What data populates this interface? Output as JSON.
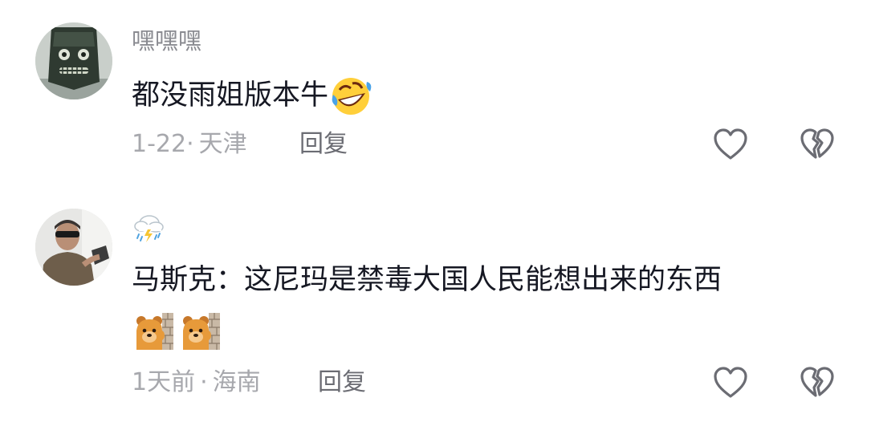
{
  "comments": [
    {
      "username": "嘿嘿嘿",
      "avatar_icon": "bronze-mask-avatar",
      "text": "都没雨姐版本牛",
      "emoji": "rolling-laughing-emoji",
      "date": "1-22",
      "location": "天津",
      "reply_label": "回复",
      "like_icon": "heart-icon",
      "dislike_icon": "broken-heart-icon"
    },
    {
      "username_icon": "thunder-cloud-icon",
      "avatar_icon": "masked-man-avatar",
      "text": "马斯克：这尼玛是禁毒大国人民能想出来的东西",
      "stickers": [
        "peeking-bear-sticker",
        "peeking-bear-sticker"
      ],
      "date": "1天前",
      "location": "海南",
      "reply_label": "回复",
      "like_icon": "heart-icon",
      "dislike_icon": "broken-heart-icon"
    }
  ],
  "meta_separator": "·"
}
